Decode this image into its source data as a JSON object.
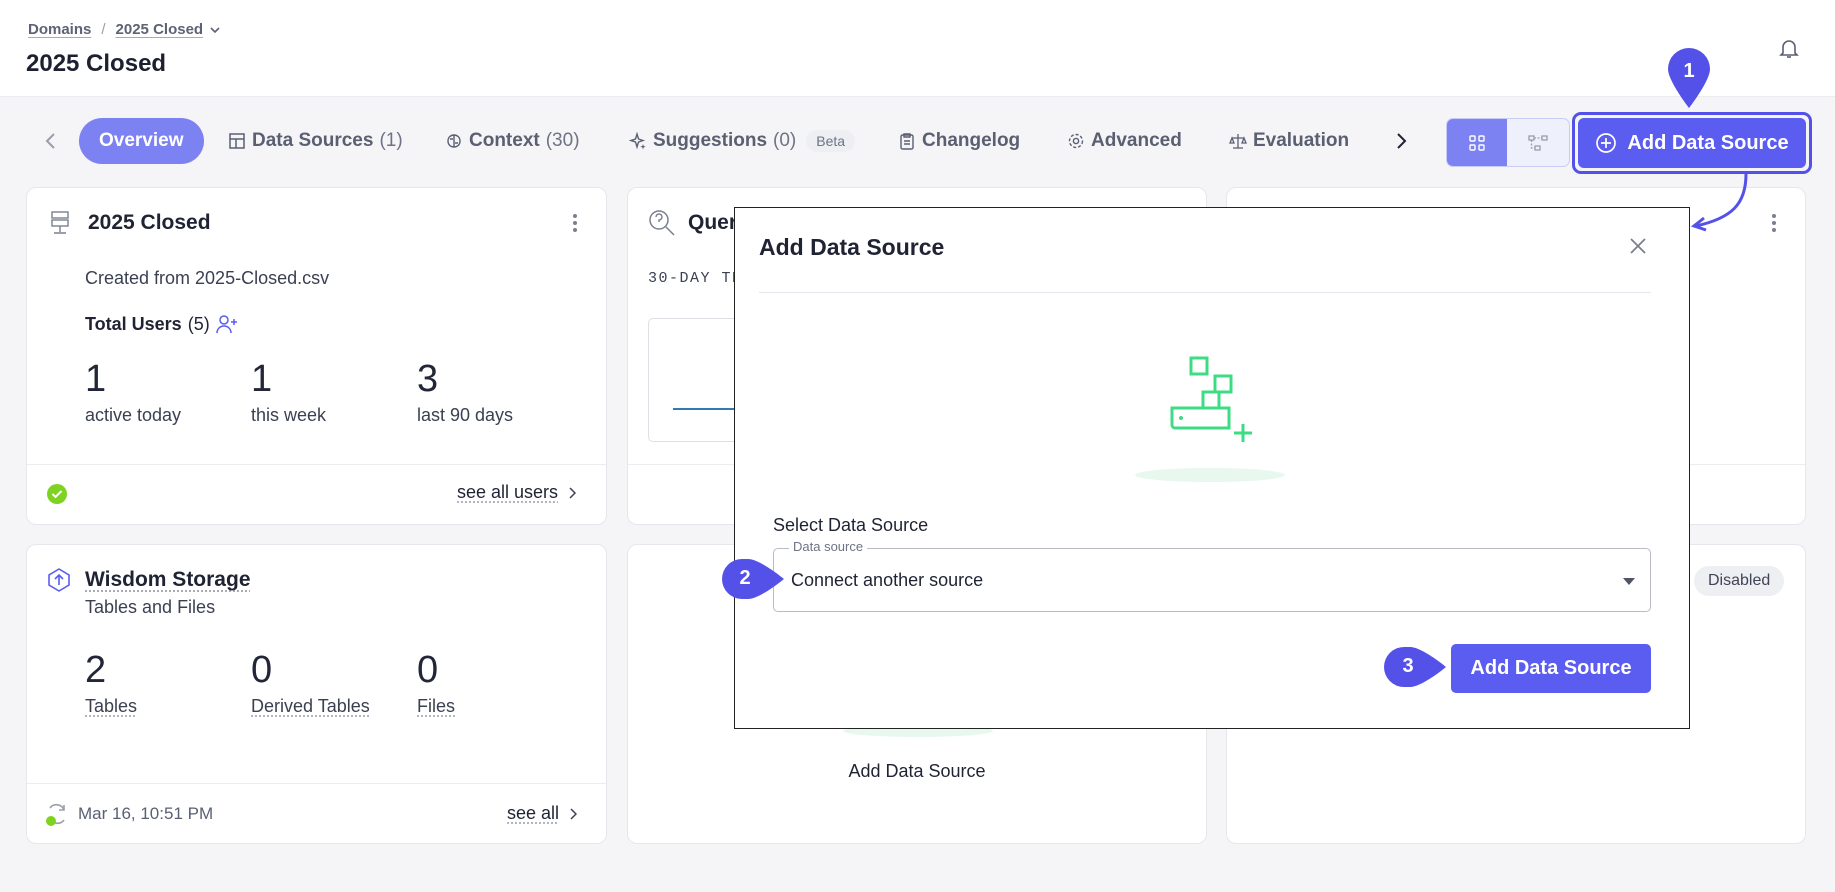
{
  "breadcrumb": {
    "root": "Domains",
    "current": "2025 Closed"
  },
  "page": {
    "title": "2025 Closed"
  },
  "tabs": [
    {
      "label": "Overview"
    },
    {
      "label": "Data Sources",
      "count": "(1)"
    },
    {
      "label": "Context",
      "count": "(30)"
    },
    {
      "label": "Suggestions",
      "count": "(0)",
      "badge": "Beta"
    },
    {
      "label": "Changelog"
    },
    {
      "label": "Advanced"
    },
    {
      "label": "Evaluation"
    }
  ],
  "toolbar": {
    "add_data_source": "Add Data Source"
  },
  "domain_card": {
    "title": "2025 Closed",
    "created_from": "Created from 2025-Closed.csv",
    "total_users_label": "Total Users",
    "total_users_count": "(5)",
    "stats": [
      {
        "value": "1",
        "label": "active today"
      },
      {
        "value": "1",
        "label": "this week"
      },
      {
        "value": "3",
        "label": "last 90 days"
      }
    ],
    "footer_link": "see all users"
  },
  "query_card": {
    "title_partial": "Quer",
    "subtitle_partial": "30-DAY TR"
  },
  "storage_card": {
    "title": "Wisdom Storage",
    "subtitle": "Tables and Files",
    "stats": [
      {
        "value": "2",
        "label": "Tables"
      },
      {
        "value": "0",
        "label": "Derived Tables"
      },
      {
        "value": "0",
        "label": "Files"
      }
    ],
    "timestamp": "Mar 16, 10:51 PM",
    "footer_link": "see all"
  },
  "middle_bottom_card": {
    "label": "Add Data Source"
  },
  "right_bottom_card": {
    "badge": "Disabled"
  },
  "dialog": {
    "title": "Add Data Source",
    "select_label": "Select Data Source",
    "field_legend": "Data source",
    "field_value": "Connect another source",
    "submit": "Add Data Source"
  },
  "markers": [
    "1",
    "2",
    "3"
  ],
  "colors": {
    "accent": "#5b5cf0",
    "tab_active": "#7c82f2",
    "illustration": "#3ddc84",
    "success": "#7ed321"
  }
}
